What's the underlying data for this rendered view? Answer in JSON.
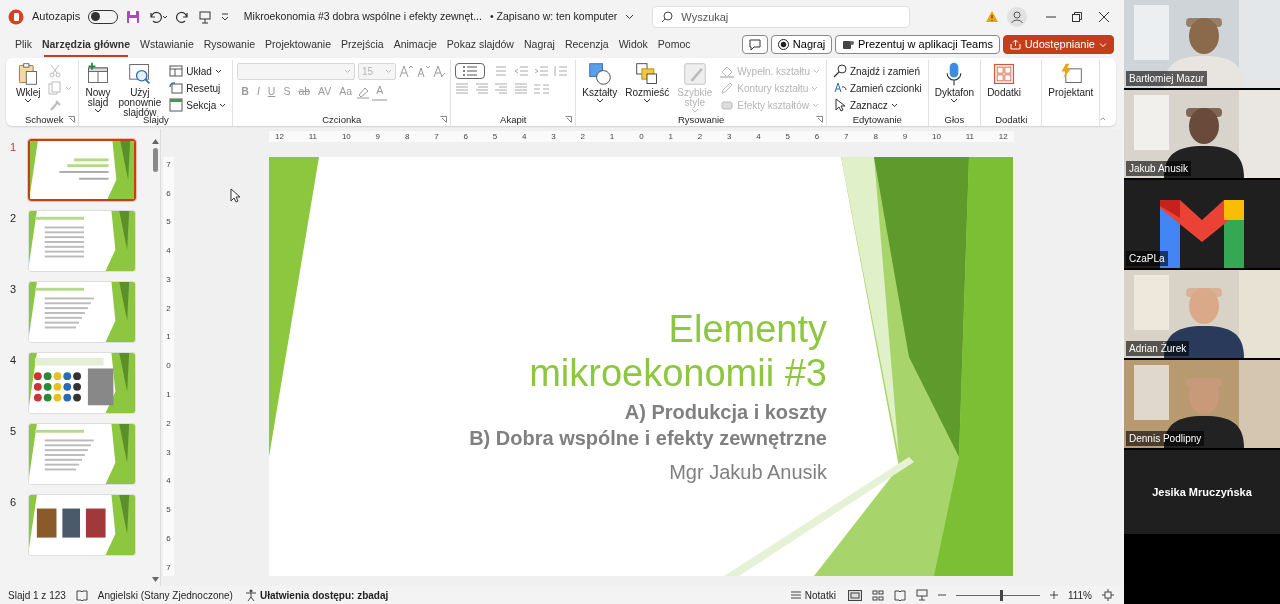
{
  "titlebar": {
    "autosave_label": "Autozapis",
    "autosave_on": false,
    "document_title": "Mikroekonomia #3 dobra wspólne i efekty zewnęt...",
    "save_status": "• Zapisano w: ten komputer",
    "search": {
      "placeholder": "Wyszukaj"
    }
  },
  "tabs": [
    {
      "label": "Plik",
      "selected": false
    },
    {
      "label": "Narzędzia główne",
      "selected": true
    },
    {
      "label": "Wstawianie",
      "selected": false
    },
    {
      "label": "Rysowanie",
      "selected": false
    },
    {
      "label": "Projektowanie",
      "selected": false
    },
    {
      "label": "Przejścia",
      "selected": false
    },
    {
      "label": "Animacje",
      "selected": false
    },
    {
      "label": "Pokaz slajdów",
      "selected": false
    },
    {
      "label": "Nagraj",
      "selected": false
    },
    {
      "label": "Recenzja",
      "selected": false
    },
    {
      "label": "Widok",
      "selected": false
    },
    {
      "label": "Pomoc",
      "selected": false
    }
  ],
  "tab_actions": [
    {
      "kind": "record",
      "label": "Nagraj"
    },
    {
      "kind": "teams",
      "label": "Prezentuj w aplikacji Teams"
    },
    {
      "kind": "share",
      "label": "Udostępnianie"
    }
  ],
  "ribbon_groups": [
    {
      "title": "Schowek",
      "launcher": true,
      "columns": [
        {
          "kind": "large",
          "label": "Wklej",
          "dropdown": true,
          "disabled": false
        },
        {
          "kind": "stack",
          "items": [
            {
              "dropdown": false,
              "disabled": true
            },
            {
              "dropdown": true,
              "disabled": true
            },
            {
              "dropdown": false,
              "disabled": true
            }
          ]
        }
      ]
    },
    {
      "title": "Slajdy",
      "launcher": false,
      "columns": [
        {
          "kind": "large",
          "label": "Nowy slajd",
          "dropdown": true,
          "disabled": false
        },
        {
          "kind": "large",
          "label": "Użyj ponownie slajdów",
          "dropdown": false,
          "disabled": false
        },
        {
          "kind": "stack",
          "items": [
            {
              "label": "Układ",
              "dropdown": true,
              "disabled": false
            },
            {
              "label": "Resetuj",
              "dropdown": false,
              "disabled": false
            },
            {
              "label": "Sekcja",
              "dropdown": true,
              "disabled": false
            }
          ]
        }
      ]
    },
    {
      "title": "Czcionka",
      "launcher": true,
      "columns": [
        {
          "kind": "font",
          "size": "15",
          "disabled": true,
          "glyphs": [
            "B",
            "I",
            "U",
            "S",
            "ab",
            "AV",
            "Aa",
            "A"
          ]
        }
      ]
    },
    {
      "title": "Akapit",
      "launcher": true,
      "columns": [
        {
          "kind": "paragraph"
        }
      ]
    },
    {
      "title": "Rysowanie",
      "launcher": true,
      "columns": [
        {
          "kind": "large",
          "label": "Kształty",
          "dropdown": true,
          "disabled": false
        },
        {
          "kind": "large",
          "label": "Rozmieść",
          "dropdown": true,
          "disabled": false
        },
        {
          "kind": "large",
          "label": "Szybkie style",
          "dropdown": true,
          "disabled": true
        },
        {
          "kind": "stack",
          "items": [
            {
              "label": "Wypełn. kształtu",
              "dropdown": true,
              "disabled": true
            },
            {
              "label": "Kontury kształtu",
              "dropdown": true,
              "disabled": true
            },
            {
              "label": "Efekty kształtów",
              "dropdown": true,
              "disabled": true
            }
          ]
        }
      ]
    },
    {
      "title": "Edytowanie",
      "launcher": false,
      "columns": [
        {
          "kind": "stack",
          "items": [
            {
              "label": "Znajdź i zamień",
              "dropdown": false,
              "disabled": false
            },
            {
              "label": "Zamień czcionki",
              "dropdown": false,
              "disabled": false
            },
            {
              "label": "Zaznacz",
              "dropdown": true,
              "disabled": false
            }
          ]
        }
      ]
    },
    {
      "title": "Głos",
      "launcher": false,
      "columns": [
        {
          "kind": "large",
          "label": "Dyktafon",
          "dropdown": true,
          "disabled": false
        }
      ]
    },
    {
      "title": "Dodatki",
      "launcher": false,
      "columns": [
        {
          "kind": "large",
          "label": "Dodatki",
          "dropdown": false,
          "disabled": false
        }
      ]
    },
    {
      "launcher": false,
      "columns": [
        {
          "kind": "large",
          "label": "Projektant",
          "dropdown": false,
          "disabled": false
        }
      ]
    }
  ],
  "thumbnails": [
    {
      "number": "1",
      "selected": true
    },
    {
      "number": "2",
      "selected": false
    },
    {
      "number": "3",
      "selected": false
    },
    {
      "number": "4",
      "selected": false
    },
    {
      "number": "5",
      "selected": false
    },
    {
      "number": "6",
      "selected": false
    }
  ],
  "ruler_h": [
    "12",
    "11",
    "10",
    "9",
    "8",
    "7",
    "6",
    "5",
    "4",
    "3",
    "2",
    "1",
    "0",
    "1",
    "2",
    "3",
    "4",
    "5",
    "6",
    "7",
    "8",
    "9",
    "10",
    "11",
    "12"
  ],
  "ruler_v": [
    "7",
    "6",
    "5",
    "4",
    "3",
    "2",
    "1",
    "0",
    "1",
    "2",
    "3",
    "4",
    "5",
    "6",
    "7"
  ],
  "slide": {
    "title_lines": [
      "Elementy",
      "mikroekonomii #3"
    ],
    "subtitle_lines": [
      "A) Produkcja i koszty",
      "B) Dobra wspólne i efekty zewnętrzne"
    ],
    "author": "Mgr Jakub Anusik"
  },
  "status_bar": {
    "slide_counter": "Slajd 1 z 123",
    "language": "Angielski (Stany Zjednoczone)",
    "accessibility": "Ułatwienia dostępu: zbadaj",
    "notes": "Notatki",
    "zoom": {
      "level": 0.54,
      "reading": "111%"
    }
  },
  "participants": [
    {
      "name": "Bartłomiej Mazur",
      "kind": "video"
    },
    {
      "name": "Jakub Anusik",
      "kind": "video"
    },
    {
      "name": "CzaPLa",
      "kind": "logo"
    },
    {
      "name": "Adrian Żurek",
      "kind": "video"
    },
    {
      "name": "Dennis Podlipny",
      "kind": "video"
    },
    {
      "name": "Jesika Mruczyńska",
      "kind": "name_only"
    }
  ]
}
